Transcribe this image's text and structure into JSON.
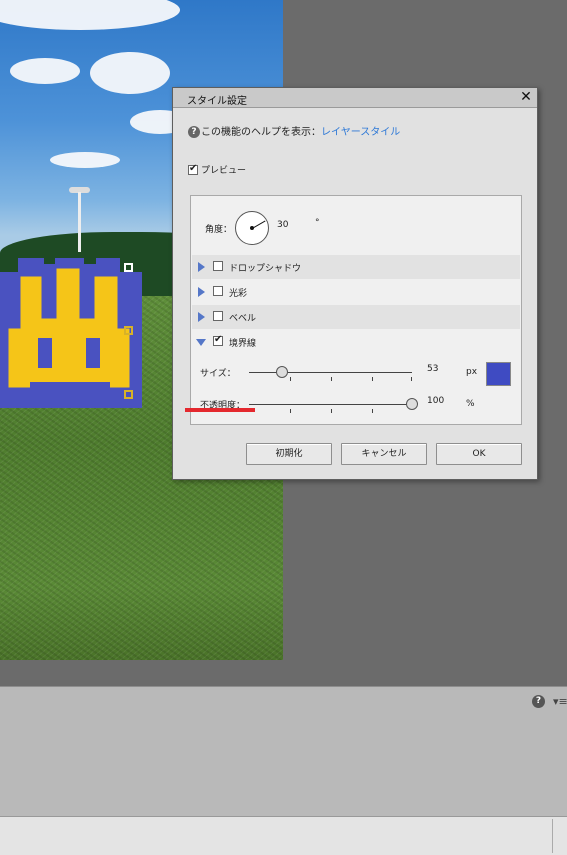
{
  "colors": {
    "accent_link": "#2d78d6",
    "border_color_swatch": "#3f4bc2",
    "glyph_fill": "#f5c518",
    "glyph_stroke": "#4a52c0",
    "highlight_underline": "#e4282e"
  },
  "dialog": {
    "title": "スタイル設定",
    "close_icon": "close-icon",
    "help_prefix": "この機能のヘルプを表示：",
    "help_link": "レイヤースタイル",
    "preview_label": "プレビュー",
    "preview_checked": true,
    "angle": {
      "label": "角度：",
      "value": "30",
      "unit": "°"
    },
    "sections": [
      {
        "label": "ドロップシャドウ",
        "checked": false,
        "expanded": false
      },
      {
        "label": "光彩",
        "checked": false,
        "expanded": false
      },
      {
        "label": "ベベル",
        "checked": false,
        "expanded": false
      },
      {
        "label": "境界線",
        "checked": true,
        "expanded": true
      }
    ],
    "stroke": {
      "size_label": "サイズ：",
      "size_value": "53",
      "size_fraction": 0.2,
      "size_unit": "px",
      "opacity_label": "不透明度：",
      "opacity_value": "100",
      "opacity_fraction": 1.0,
      "opacity_unit": "%"
    },
    "buttons": {
      "reset": "初期化",
      "cancel": "キャンセル",
      "ok": "OK"
    }
  },
  "bottom_panel": {
    "help_icon": "help-icon",
    "menu_icon": "panel-menu-icon"
  }
}
